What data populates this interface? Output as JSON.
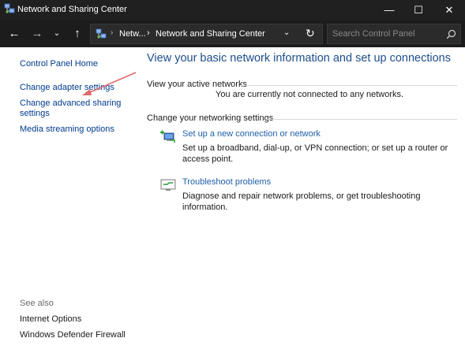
{
  "window": {
    "title": "Network and Sharing Center",
    "minimize_glyph": "—",
    "maximize_glyph": "☐",
    "close_glyph": "✕"
  },
  "nav": {
    "back_glyph": "←",
    "forward_glyph": "→",
    "history_glyph": "⌄",
    "up_glyph": "↑",
    "address": {
      "separator": "›",
      "crumbs": [
        "Netw...",
        "Network and Sharing Center"
      ],
      "dropdown_glyph": "⌄",
      "refresh_glyph": "↻"
    },
    "search": {
      "placeholder": "Search Control Panel",
      "icon": "search-icon"
    }
  },
  "sidebar": {
    "home": "Control Panel Home",
    "items": [
      {
        "label": "Change adapter settings"
      },
      {
        "label": "Change advanced sharing settings"
      },
      {
        "label": "Media streaming options"
      }
    ],
    "see_also_label": "See also",
    "see_also": [
      {
        "label": "Internet Options"
      },
      {
        "label": "Windows Defender Firewall"
      }
    ]
  },
  "main": {
    "title": "View your basic network information and set up connections",
    "active_networks": {
      "heading": "View your active networks",
      "status": "You are currently not connected to any networks."
    },
    "change_settings": {
      "heading": "Change your networking settings",
      "tasks": [
        {
          "icon": "new-connection-icon",
          "label": "Set up a new connection or network",
          "description": "Set up a broadband, dial-up, or VPN connection; or set up a router or access point."
        },
        {
          "icon": "troubleshoot-icon",
          "label": "Troubleshoot problems",
          "description": "Diagnose and repair network problems, or get troubleshooting information."
        }
      ]
    }
  },
  "annotation": {
    "color": "#e06a6a"
  }
}
